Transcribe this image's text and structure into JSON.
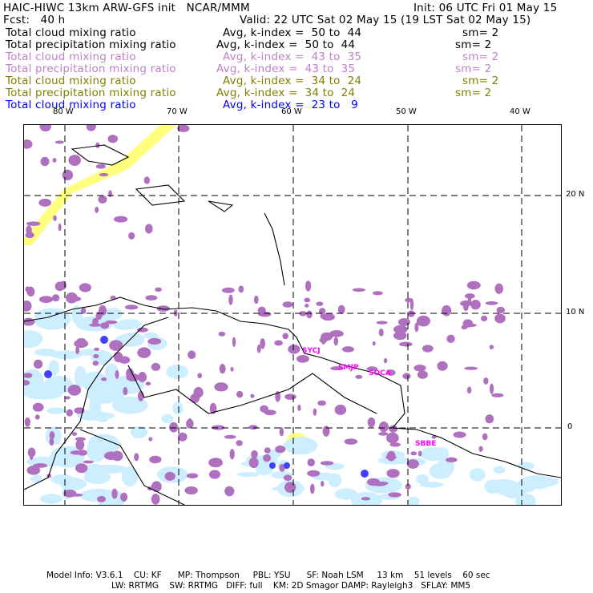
{
  "header": {
    "title": "HAIC-HIWC 13km ARW-GFS init   NCAR/MMM",
    "init": "Init: 06 UTC Fri 01 May 15",
    "fcst": "Fcst:   40 h",
    "valid": "Valid: 22 UTC Sat 02 May 15 (19 LST Sat 02 May 15)"
  },
  "legend": [
    {
      "field": "Total cloud mixing ratio",
      "avg": "Avg, k-index =  50 to  44",
      "sm": "sm= 2",
      "color": "#000000"
    },
    {
      "field": "Total precipitation mixing ratio",
      "avg": "Avg, k-index =  50 to  44",
      "sm": "sm= 2",
      "color": "#000000"
    },
    {
      "field": "Total cloud mixing ratio",
      "avg": "Avg, k-index =  43 to  35",
      "sm": "sm= 2",
      "color": "#c080c8"
    },
    {
      "field": "Total precipitation mixing ratio",
      "avg": "Avg, k-index =  43 to  35",
      "sm": "sm= 2",
      "color": "#c080c8"
    },
    {
      "field": "Total cloud mixing ratio",
      "avg": "Avg, k-index =  34 to  24",
      "sm": "sm= 2",
      "color": "#808000"
    },
    {
      "field": "Total precipitation mixing ratio",
      "avg": "Avg, k-index =  34 to  24",
      "sm": "sm= 2",
      "color": "#808000"
    },
    {
      "field": "Total cloud mixing ratio",
      "avg": "Avg, k-index =  23 to   9",
      "color": "#0000ff"
    }
  ],
  "map": {
    "lon_labels": [
      "80 W",
      "70 W",
      "60 W",
      "50 W",
      "40 W"
    ],
    "lat_labels": [
      "20 N",
      "10 N",
      "0"
    ],
    "stations": [
      "SYCJ",
      "SMJP",
      "SOCA",
      "SBBE"
    ]
  },
  "footer": {
    "line1": "Model Info: V3.6.1    CU: KF      MP: Thompson     PBL: YSU      SF: Noah LSM     13 km    51 levels    60 sec",
    "line2": "LW: RRTMG    SW: RRTMG   DIFF: full    KM: 2D Smagor DAMP: Rayleigh3   SFLAY: MM5"
  }
}
